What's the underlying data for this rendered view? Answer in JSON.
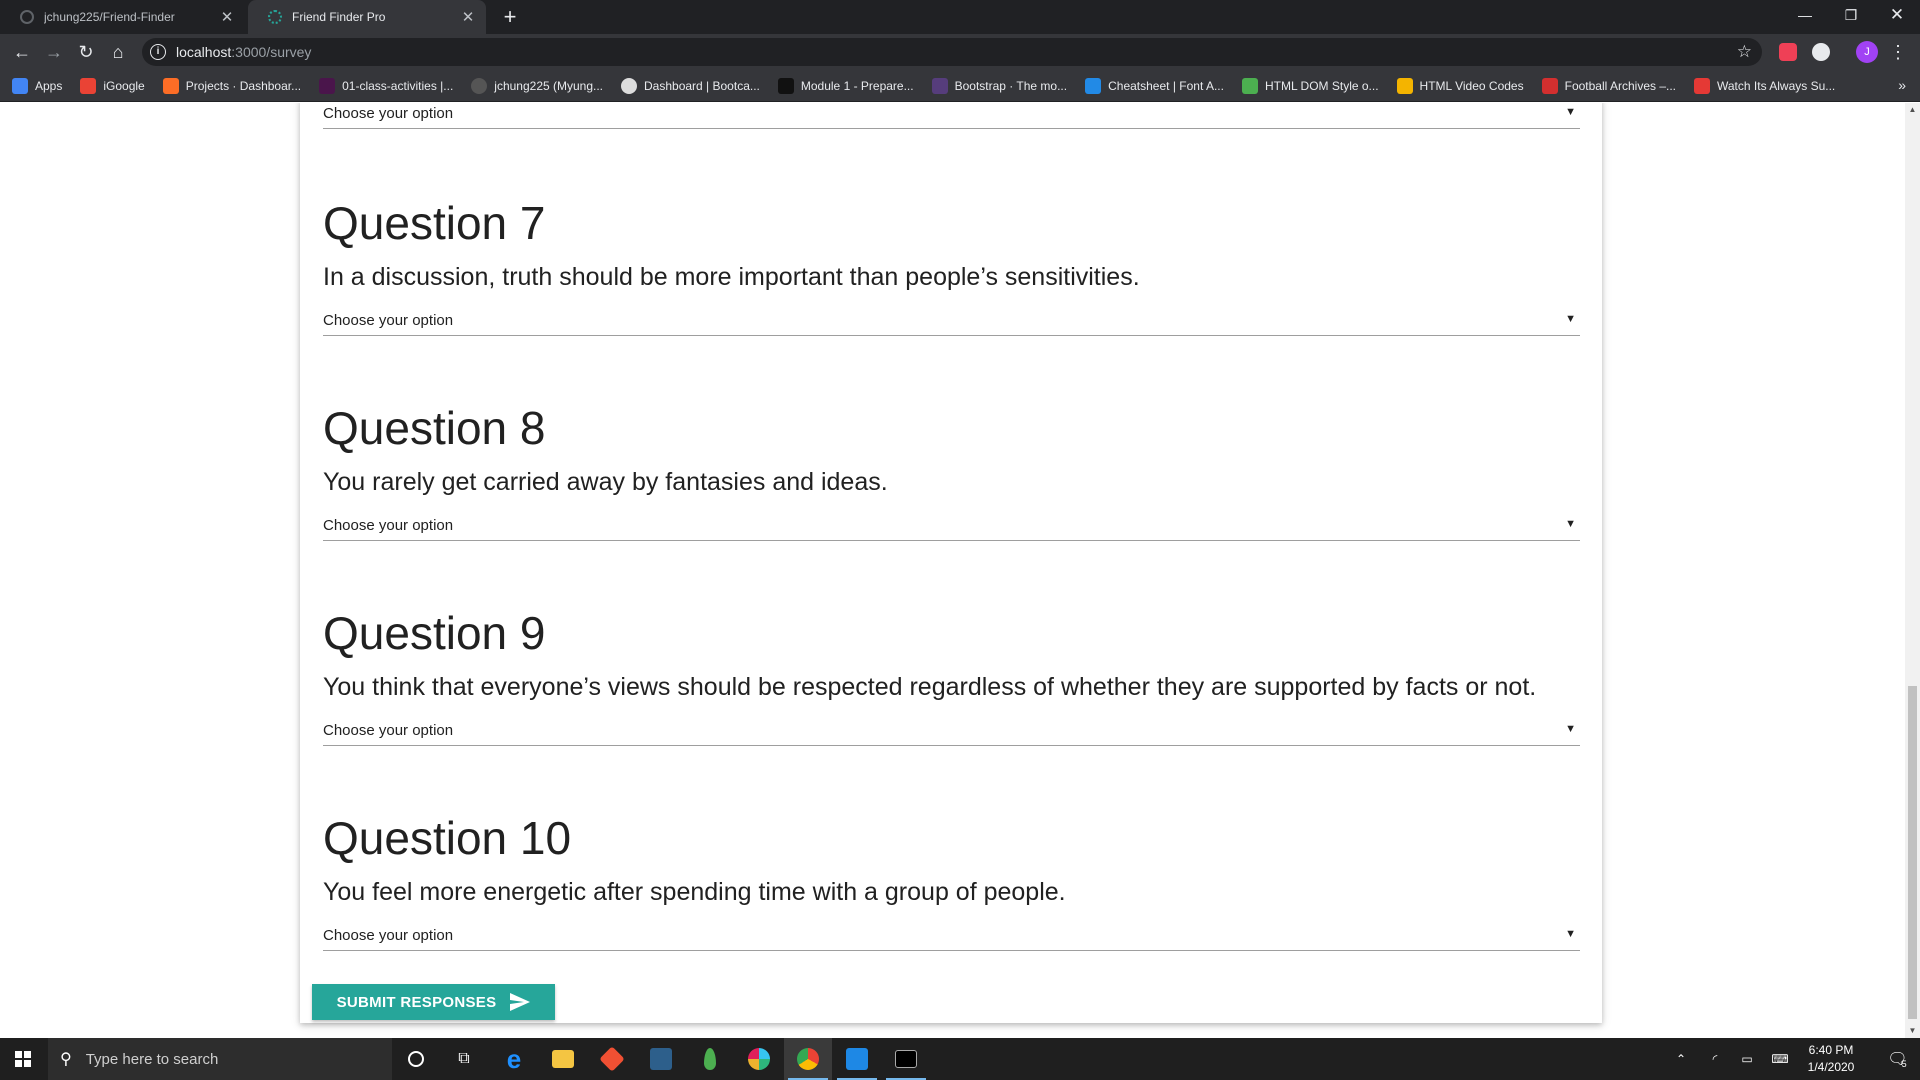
{
  "browser": {
    "tabs": [
      {
        "title": "jchung225/Friend-Finder",
        "active": false,
        "favicon": "github-icon"
      },
      {
        "title": "Friend Finder Pro",
        "active": true,
        "favicon": "friend-finder-icon"
      }
    ],
    "address": {
      "host": "localhost",
      "path": ":3000/survey"
    },
    "bookmarks": [
      {
        "label": "Apps",
        "icon": "apps-grid-icon",
        "color": "#4285f4"
      },
      {
        "label": "iGoogle",
        "icon": "igoogle-icon",
        "color": "#ea4335"
      },
      {
        "label": "Projects · Dashboar...",
        "icon": "gitlab-icon",
        "color": "#fc6d26"
      },
      {
        "label": "01-class-activities |...",
        "icon": "slack-icon",
        "color": "#4a154b"
      },
      {
        "label": "jchung225 (Myung...",
        "icon": "github-icon",
        "color": "#555555"
      },
      {
        "label": "Dashboard | Bootca...",
        "icon": "bootcamp-icon",
        "color": "#dddddd"
      },
      {
        "label": "Module 1 - Prepare...",
        "icon": "module-icon",
        "color": "#222222"
      },
      {
        "label": "Bootstrap · The mo...",
        "icon": "bootstrap-icon",
        "color": "#563d7c"
      },
      {
        "label": "Cheatsheet | Font A...",
        "icon": "font-awesome-icon",
        "color": "#228ae6"
      },
      {
        "label": "HTML DOM Style o...",
        "icon": "w3schools-icon",
        "color": "#4caf50"
      },
      {
        "label": "HTML Video Codes",
        "icon": "video-codes-icon",
        "color": "#f4b400"
      },
      {
        "label": "Football Archives –...",
        "icon": "ts-icon",
        "color": "#d32f2f"
      },
      {
        "label": "Watch Its Always Su...",
        "icon": "watch-icon",
        "color": "#e53935"
      }
    ],
    "user_initial": "J"
  },
  "survey": {
    "top_select": "Choose your option",
    "questions": [
      {
        "title": "Question 7",
        "text": "In a discussion, truth should be more important than people’s sensitivities.",
        "select": "Choose your option"
      },
      {
        "title": "Question 8",
        "text": "You rarely get carried away by fantasies and ideas.",
        "select": "Choose your option"
      },
      {
        "title": "Question 9",
        "text": "You think that everyone’s views should be respected regardless of whether they are supported by facts or not.",
        "select": "Choose your option"
      },
      {
        "title": "Question 10",
        "text": "You feel more energetic after spending time with a group of people.",
        "select": "Choose your option"
      }
    ],
    "submit_label": "Submit Responses",
    "accent_color": "#26a69a"
  },
  "taskbar": {
    "search_placeholder": "Type here to search",
    "time": "6:40 PM",
    "date": "1/4/2020",
    "notification_count": "5"
  }
}
